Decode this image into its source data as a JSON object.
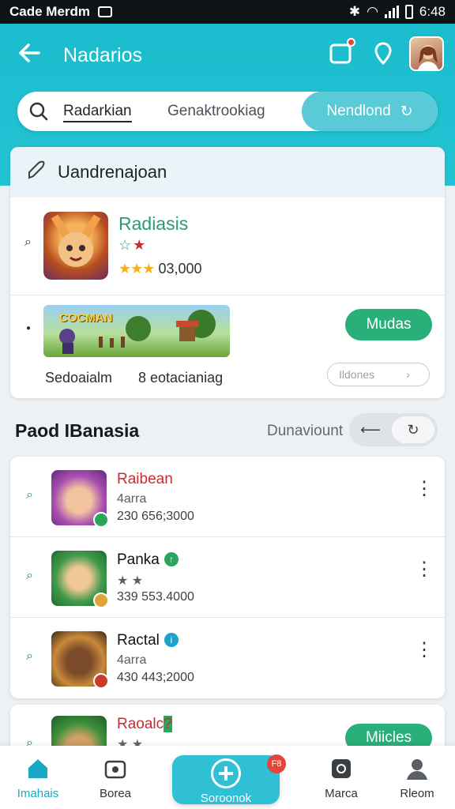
{
  "status_bar": {
    "carrier": "Cade Merdm",
    "time": "6:48"
  },
  "header": {
    "title": "Nadarios"
  },
  "search": {
    "query": "Radarkian",
    "placeholder": "Genaktrookiag",
    "button_label": "Nendlond"
  },
  "featured": {
    "heading": "Uandrenajoan",
    "app": {
      "name": "Radiasis",
      "rating_count": "03,000"
    },
    "banner_text": "COCMAN",
    "button_label": "Mudas",
    "footer_left": "Sedoaialm",
    "footer_right": "8 eotacianiag",
    "small_button": "Ildones"
  },
  "section": {
    "title": "Paod IBanasia",
    "link": "Dunaviount"
  },
  "list": [
    {
      "name": "Raibean",
      "sub": "4arra",
      "meta": "230 656;3000",
      "name_color": "#c62d33"
    },
    {
      "name": "Panka",
      "sub": "★ ★",
      "meta": "339 553.4000",
      "name_color": "#111111"
    },
    {
      "name": "Ractal",
      "sub": "4arra",
      "meta": "430 443;2000",
      "name_color": "#111111"
    }
  ],
  "card4": {
    "name": "Raoalc",
    "button_label": "Miicles"
  },
  "bottom_nav": {
    "home": "Imahais",
    "store": "Borea",
    "center": "Soroonok",
    "center_badge": "F8",
    "media": "Marca",
    "profile": "Rleom"
  },
  "colors": {
    "accent": "#22c4d4",
    "green": "#29b07a",
    "red": "#c62d33"
  },
  "icons": [
    "back-arrow-icon",
    "notification-icon",
    "location-pin-icon",
    "search-icon",
    "refresh-icon",
    "pin-icon",
    "more-icon",
    "home-icon",
    "store-icon",
    "plus-icon",
    "media-icon",
    "profile-icon"
  ]
}
